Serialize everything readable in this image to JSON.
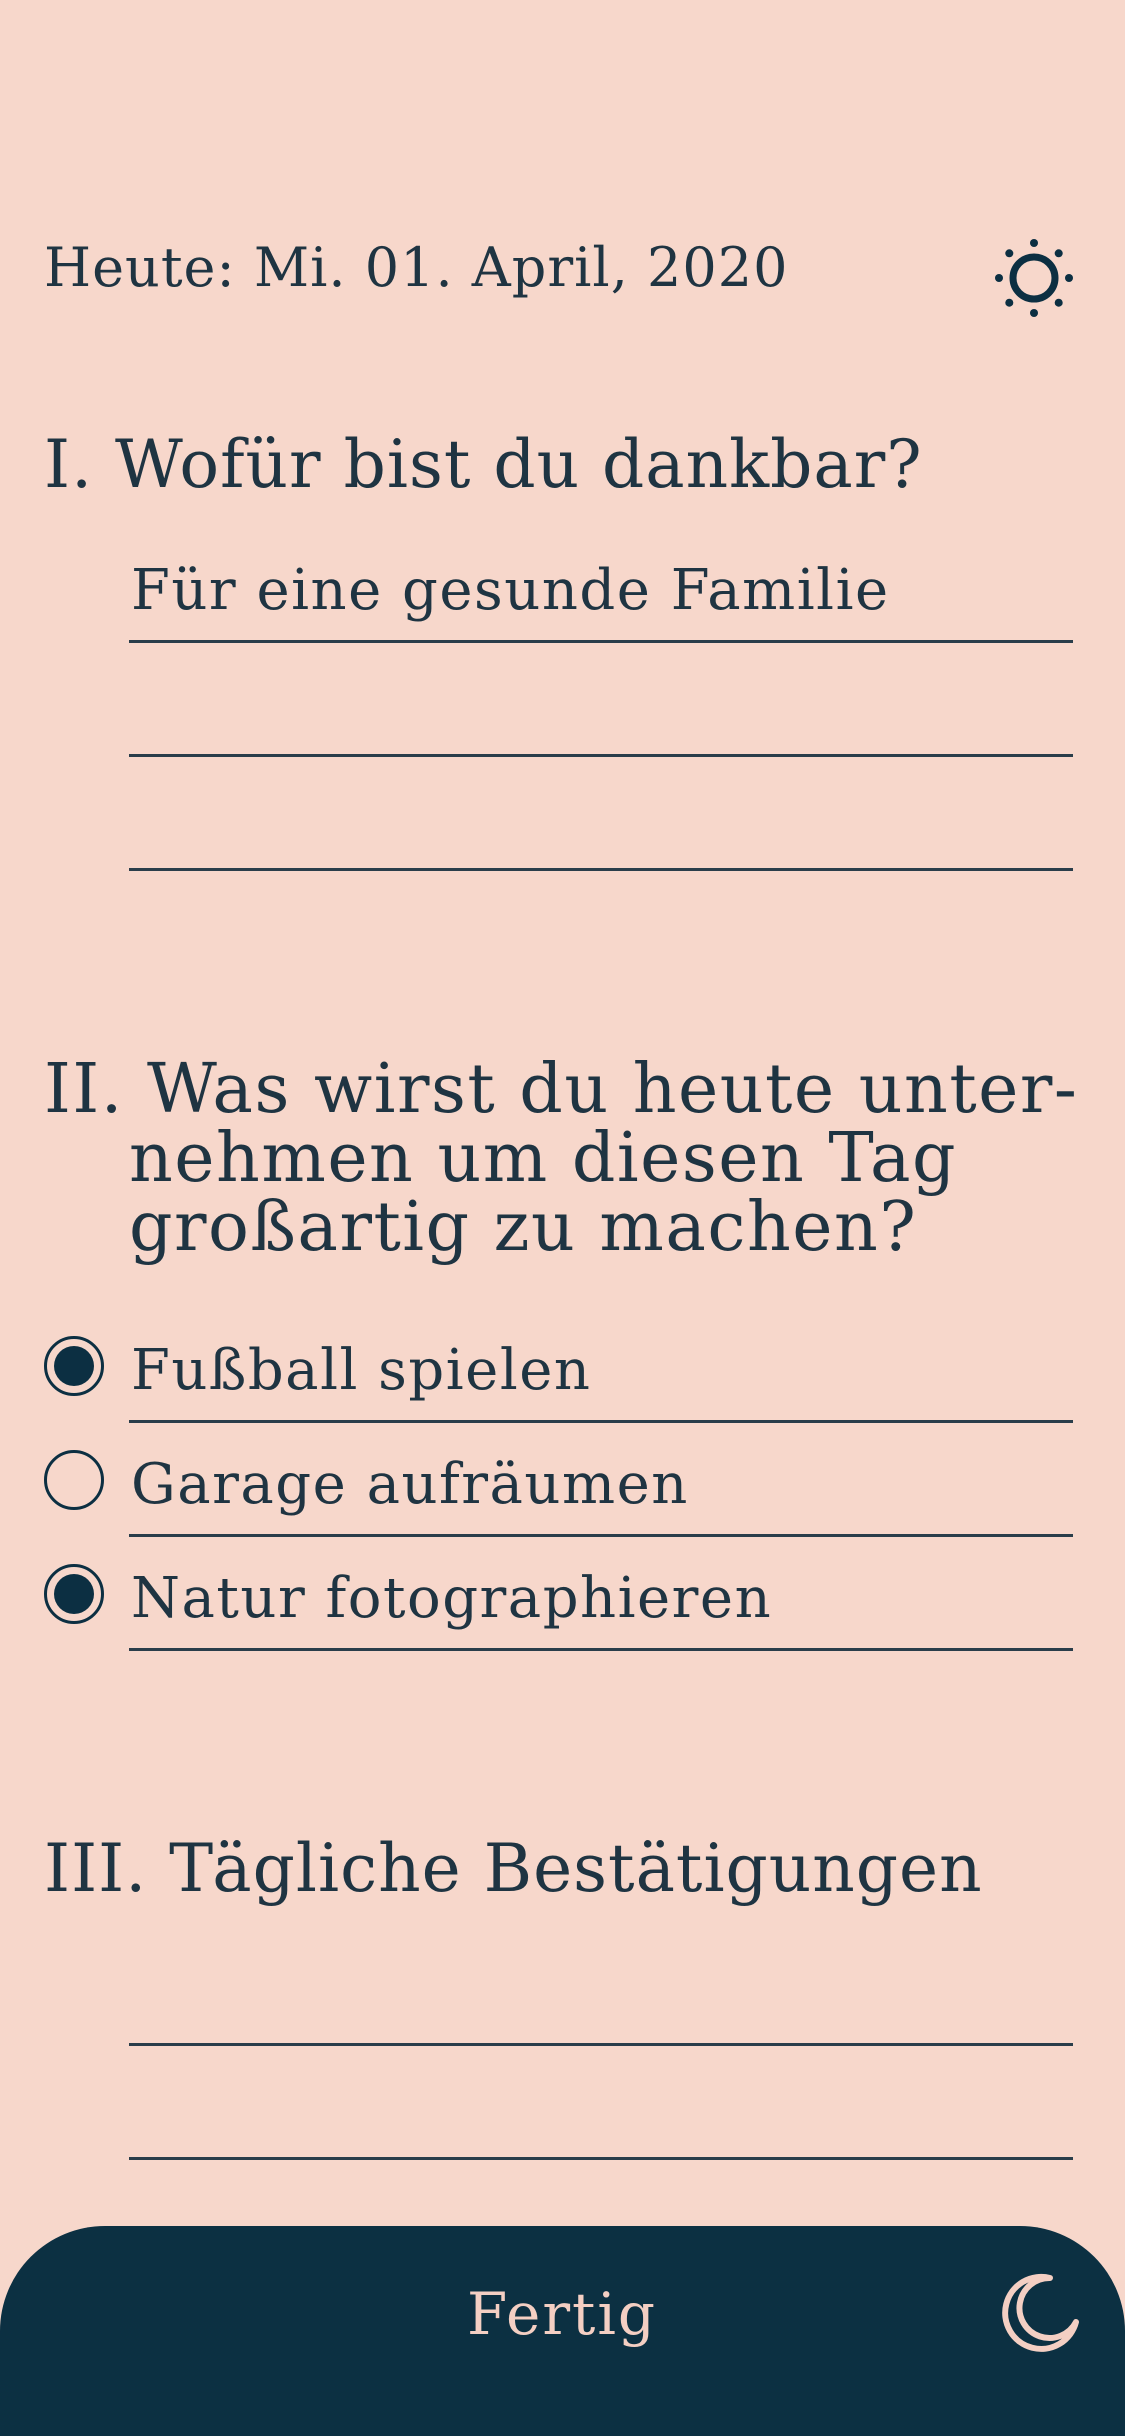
{
  "header": {
    "date": "Heute: Mi. 01. April, 2020",
    "theme_icon": "sun-icon"
  },
  "section1": {
    "heading": "I. Wofür bist du dankbar?",
    "entries": [
      "Für eine gesunde Familie",
      "",
      ""
    ]
  },
  "section2": {
    "heading_lines": [
      "II. Was wirst du heute unter-",
      "nehmen um diesen Tag",
      "großartig zu machen?"
    ],
    "items": [
      {
        "label": "Fußball spielen",
        "checked": true
      },
      {
        "label": "Garage aufräumen",
        "checked": false
      },
      {
        "label": "Natur fotographieren",
        "checked": true
      }
    ]
  },
  "section3": {
    "heading": "III. Tägliche Bestätigungen",
    "entries": [
      "",
      ""
    ]
  },
  "footer": {
    "done_label": "Fertig",
    "night_icon": "moon-icon"
  },
  "colors": {
    "background": "#f7d7cb",
    "ink": "#1f3442",
    "accent": "#0c3042",
    "footer_text": "#f4cfc3"
  }
}
